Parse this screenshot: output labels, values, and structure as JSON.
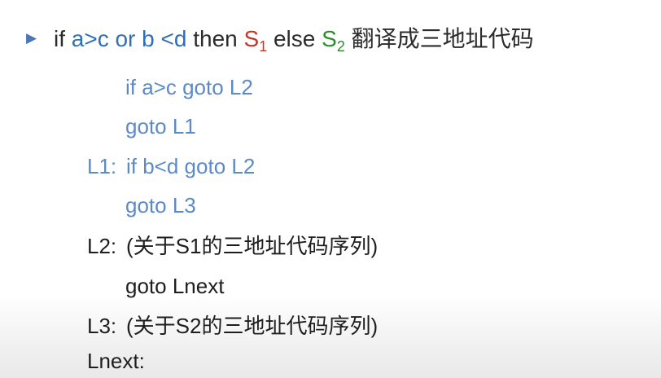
{
  "title": {
    "bullet": "▶",
    "if": "if",
    "cond": "a>c or b <d",
    "then": "then",
    "s1": "S",
    "s1_sub": "1",
    "else": "else",
    "s2": "S",
    "s2_sub": "2",
    "tail": "翻译成三地址代码"
  },
  "lines": [
    {
      "label": "",
      "code": "if a>c goto L2"
    },
    {
      "label": "",
      "code": "goto L1"
    },
    {
      "label": "L1:",
      "code": "if b<d goto L2"
    },
    {
      "label": "",
      "code": "goto L3"
    },
    {
      "label": "L2:",
      "code": "(关于S1的三地址代码序列)"
    },
    {
      "label": "",
      "code": "goto Lnext"
    },
    {
      "label": "L3:",
      "code": "(关于S2的三地址代码序列)"
    },
    {
      "label": "Lnext:",
      "code": ""
    }
  ],
  "colors": {
    "blue_code": "#5b8ac7",
    "dark_code": "#1e1e1e",
    "s1": "#c0392b",
    "s2": "#2e8b2e",
    "bullet": "#4a76b8"
  }
}
